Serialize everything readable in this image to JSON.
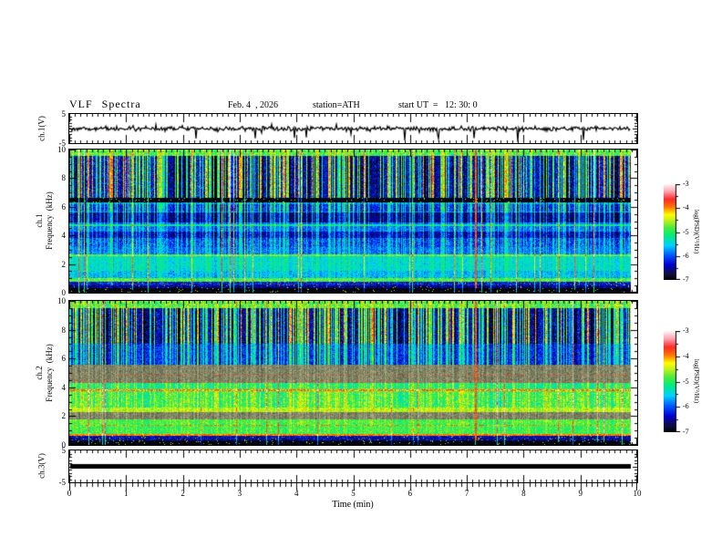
{
  "header": {
    "title": "VLF  Spectra",
    "date": "Feb. 4  , 2026",
    "station": "station=ATH",
    "start_ut": "start UT  =   12: 30: 0"
  },
  "axes": {
    "time": {
      "label": "Time  (min)",
      "min": 0,
      "max": 10,
      "minor_step": 0.1,
      "tick_labels": [
        "0",
        "1",
        "2",
        "3",
        "4",
        "5",
        "6",
        "7",
        "8",
        "9",
        "10"
      ]
    },
    "frequency": {
      "min": 0,
      "max": 10,
      "minor_step": 0.5,
      "tick_labels": [
        "10",
        "8",
        "6",
        "4",
        "2",
        "0"
      ]
    },
    "volts": {
      "tick_labels": [
        "5",
        "-5"
      ],
      "min": -5,
      "max": 5
    }
  },
  "ylabels": {
    "ch1v": "ch.1(V)",
    "ch1f": "ch.1\nFrequency  (kHz)",
    "ch2f": "ch.2\nFrequency  (kHz)",
    "ch3v": "ch.3(V)"
  },
  "colorbar": {
    "label": "log(PSD)(V²/Hz)",
    "tick_labels": [
      "-3",
      "-4",
      "-5",
      "-6",
      "-7"
    ],
    "min": -7,
    "max": -3,
    "minor_step": 0.5
  },
  "colormap": [
    {
      "t": 0.0,
      "c": "#000000"
    },
    {
      "t": 0.06,
      "c": "#0f0f3c"
    },
    {
      "t": 0.16,
      "c": "#0000d2"
    },
    {
      "t": 0.26,
      "c": "#005aff"
    },
    {
      "t": 0.36,
      "c": "#00d2ff"
    },
    {
      "t": 0.46,
      "c": "#00eb82"
    },
    {
      "t": 0.54,
      "c": "#46eb3c"
    },
    {
      "t": 0.62,
      "c": "#bef01e"
    },
    {
      "t": 0.68,
      "c": "#ffff00"
    },
    {
      "t": 0.76,
      "c": "#ff7800"
    },
    {
      "t": 0.84,
      "c": "#ff2828"
    },
    {
      "t": 0.92,
      "c": "#ffa0aa"
    },
    {
      "t": 1.0,
      "c": "#fff8fc"
    }
  ],
  "chart_data": [
    {
      "id": "ch1_waveform",
      "type": "line",
      "name": "ch.1(V)",
      "xlim_min": [
        0,
        10
      ],
      "time_end_min": 9.88,
      "ylim_v": [
        -5,
        5
      ],
      "mean_v": 0,
      "typical_noise_v": 0.4,
      "spike_range_v": [
        -4.5,
        2.5
      ],
      "seed": 1337,
      "summary": "Noisy signal around 0 V with frequent brief spikes, mostly downward to about -4 V"
    },
    {
      "id": "ch1_spectrogram",
      "type": "heatmap",
      "name": "ch.1 Frequency (kHz)",
      "xlim_min": [
        0,
        10
      ],
      "time_end_min": 9.88,
      "flim_khz": [
        0,
        10
      ],
      "zlim_logpsd": [
        -7,
        -3
      ],
      "seed": 20260204,
      "streaks": {
        "prob": 0.4,
        "full_prob": 0.045
      },
      "events": [
        {
          "t": 7.15,
          "width": 2,
          "level": -3.8
        }
      ],
      "bands": [
        {
          "f": [
            9.55,
            10.01
          ],
          "level": -4.9,
          "noise": 0.45,
          "streak": 0.5
        },
        {
          "f": [
            6.6,
            9.55
          ],
          "level": -6.35,
          "noise": 0.45,
          "streak": 2.0,
          "slow": 0.4
        },
        {
          "f": [
            6.18,
            6.3
          ],
          "level": -5.75,
          "noise": 0.3,
          "streak": 0.8
        },
        {
          "f": [
            5.68,
            6.18
          ],
          "level": -6.15,
          "noise": 0.35,
          "streak": 1.1
        },
        {
          "f": [
            5.58,
            5.68
          ],
          "level": -5.8,
          "noise": 0.3,
          "streak": 0.8
        },
        {
          "f": [
            4.9,
            5.58
          ],
          "level": -6.6,
          "noise": 0.25,
          "streak": 0.9
        },
        {
          "f": [
            4.62,
            4.76
          ],
          "level": -5.3,
          "noise": 0.3,
          "streak": 0.4
        },
        {
          "f": [
            4.25,
            4.9
          ],
          "level": -5.95,
          "noise": 0.3,
          "streak": 0.6
        },
        {
          "f": [
            3.85,
            4.25
          ],
          "level": -6.45,
          "noise": 0.3,
          "streak": 0.7
        },
        {
          "f": [
            3.2,
            3.85
          ],
          "level": -6.05,
          "noise": 0.4,
          "streak": 0.7
        },
        {
          "f": [
            2.68,
            3.2
          ],
          "level": -5.9,
          "noise": 0.3,
          "streak": 0.5
        },
        {
          "f": [
            2.52,
            2.68
          ],
          "level": -4.8,
          "noise": 0.25,
          "streak": 0.2
        },
        {
          "f": [
            1.55,
            2.52
          ],
          "level": -5.45,
          "noise": 0.25,
          "streak": 0.3
        },
        {
          "f": [
            1.0,
            1.55
          ],
          "level": -5.65,
          "noise": 0.3,
          "streak": 0.3
        },
        {
          "f": [
            0.74,
            1.0
          ],
          "level": -4.9,
          "noise": 0.35,
          "streak": 0.15
        },
        {
          "f": [
            0.5,
            0.74
          ],
          "level": -6.35,
          "noise": 0.5,
          "streak": 0.2,
          "dot": 0.03
        },
        {
          "f": [
            0.35,
            0.5
          ],
          "level": -6.6,
          "noise": 0.4,
          "streak": 0.1,
          "dot": 0.02
        },
        {
          "f": [
            0,
            0.35
          ],
          "level": -6.95,
          "noise": 0.15,
          "streak": 0.05,
          "dot": 0.04
        }
      ],
      "summary": "Dense vertical green/cyan impulse streaks over dark blue background above 4 kHz; cyan band 1-2.5 kHz; bright narrow lines near 4.7, 2.6, 0.9 kHz; black band below 0.35 kHz"
    },
    {
      "id": "ch2_spectrogram",
      "type": "heatmap",
      "name": "ch.2 Frequency (kHz)",
      "xlim_min": [
        0,
        10
      ],
      "time_end_min": 9.88,
      "flim_khz": [
        0,
        10
      ],
      "zlim_logpsd": [
        -7,
        -3
      ],
      "seed": 424242,
      "streaks": {
        "prob": 0.42,
        "full_prob": 0.045
      },
      "events": [
        {
          "t": 7.15,
          "width": 2,
          "level": -3.8
        }
      ],
      "bands": [
        {
          "f": [
            9.5,
            10.01
          ],
          "level": -4.9,
          "noise": 0.45,
          "streak": 0.5
        },
        {
          "f": [
            7.0,
            9.5
          ],
          "level": -6.45,
          "noise": 0.45,
          "streak": 2.1,
          "slow": 0.4
        },
        {
          "f": [
            5.6,
            7.0
          ],
          "level": -6.15,
          "noise": 0.35,
          "streak": 1.1
        },
        {
          "f": [
            5.05,
            5.6
          ],
          "level": -5.9,
          "noise": 0.3,
          "streak": 0.5,
          "gray": true
        },
        {
          "f": [
            4.9,
            5.05
          ],
          "level": -5.6,
          "noise": 0.3,
          "streak": 0.4,
          "gray": true
        },
        {
          "f": [
            4.8,
            4.9
          ],
          "level": -5.4,
          "noise": 0.3,
          "streak": 0.3,
          "gray": true,
          "rs": 0.25
        },
        {
          "f": [
            4.55,
            4.8
          ],
          "level": -5.6,
          "noise": 0.3,
          "streak": 0.4,
          "gray": true
        },
        {
          "f": [
            4.3,
            4.55
          ],
          "level": -5.3,
          "noise": 0.3,
          "streak": 0.4,
          "gray": true,
          "rs": 0.06
        },
        {
          "f": [
            3.85,
            4.3
          ],
          "level": -5.15,
          "noise": 0.35,
          "streak": 0.5
        },
        {
          "f": [
            3.74,
            3.85
          ],
          "level": -4.2,
          "noise": 0.3,
          "streak": 0.2,
          "rs": 0.35
        },
        {
          "f": [
            2.6,
            3.74
          ],
          "level": -5.0,
          "noise": 0.4,
          "streak": 0.5,
          "slow": 0.5
        },
        {
          "f": [
            2.3,
            2.6
          ],
          "level": -4.6,
          "noise": 0.3,
          "streak": 0.3
        },
        {
          "f": [
            2.05,
            2.3
          ],
          "level": -5.75,
          "noise": 0.3,
          "streak": 0.2,
          "gray": true
        },
        {
          "f": [
            1.8,
            2.05
          ],
          "level": -5.4,
          "noise": 0.3,
          "streak": 0.2,
          "gray": true
        },
        {
          "f": [
            1.42,
            1.8
          ],
          "level": -4.9,
          "noise": 0.3,
          "streak": 0.2,
          "slow": 0.3
        },
        {
          "f": [
            1.3,
            1.42
          ],
          "level": -4.8,
          "noise": 0.25,
          "streak": 0.15,
          "rs": 0.3
        },
        {
          "f": [
            0.75,
            1.3
          ],
          "level": -4.95,
          "noise": 0.3,
          "streak": 0.2
        },
        {
          "f": [
            0.64,
            0.75
          ],
          "level": -4.0,
          "noise": 0.25,
          "streak": 0.1,
          "rs": 0.15
        },
        {
          "f": [
            0.3,
            0.64
          ],
          "level": -6.5,
          "noise": 0.4,
          "streak": 0.15,
          "dot": 0.03
        },
        {
          "f": [
            0,
            0.3
          ],
          "level": -6.95,
          "noise": 0.15,
          "streak": 0.05,
          "dot": 0.04
        }
      ],
      "summary": "Similar impulse streaks above 5.5 kHz; brighter green/yellow 0.7-4.3 kHz; grayish bands near 2, 4.3-5.6 kHz; red speckled lines near 0.7, 1.35, 3.8, 4.85 kHz; black band below 0.3 kHz"
    },
    {
      "id": "ch3_waveform",
      "type": "line",
      "name": "ch.3(V)",
      "xlim_min": [
        0,
        10
      ],
      "time_end_min": 9.88,
      "ylim_v": [
        -5,
        5
      ],
      "constant_v": 0,
      "line_thickness_v": 0.8,
      "summary": "Flat thick black trace at 0 V (no signal)"
    }
  ]
}
